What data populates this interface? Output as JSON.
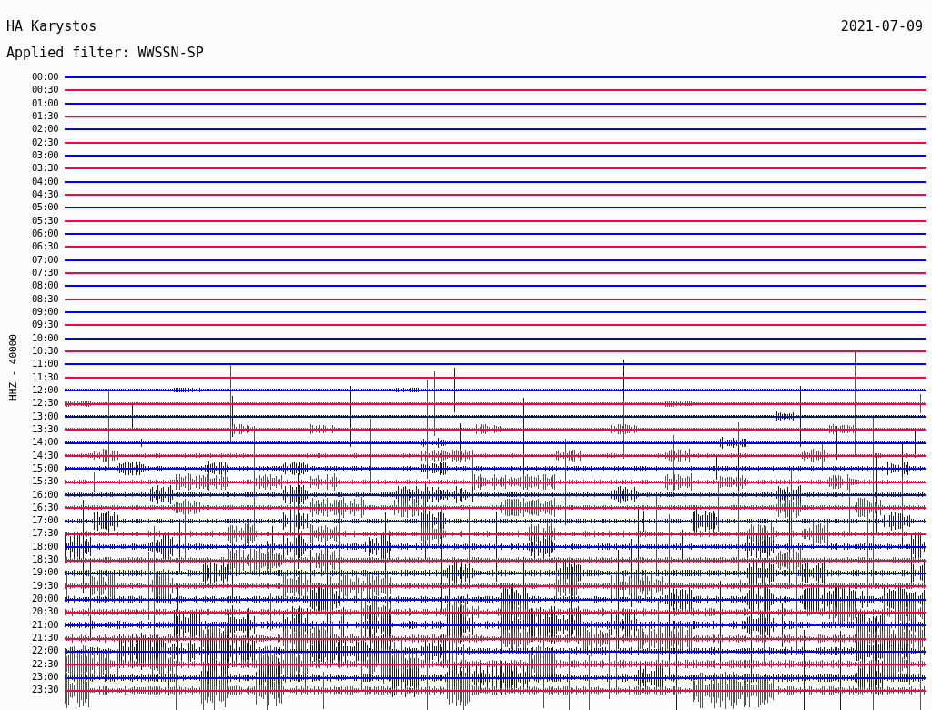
{
  "station": "HA Karystos",
  "date": "2021-07-09",
  "filter": "Applied filter: WWSSN-SP",
  "axis_label": "HHZ - 40000",
  "rows": [
    {
      "time": "00:00",
      "color": "#0000ff"
    },
    {
      "time": "00:30",
      "color": "#ff0040"
    },
    {
      "time": "01:00",
      "color": "#0000ff"
    },
    {
      "time": "01:30",
      "color": "#ff0040"
    },
    {
      "time": "02:00",
      "color": "#0000ff"
    },
    {
      "time": "02:30",
      "color": "#ff0040"
    },
    {
      "time": "03:00",
      "color": "#0000ff"
    },
    {
      "time": "03:30",
      "color": "#ff0040"
    },
    {
      "time": "04:00",
      "color": "#0000ff"
    },
    {
      "time": "04:30",
      "color": "#ff0040"
    },
    {
      "time": "05:00",
      "color": "#0000ff"
    },
    {
      "time": "05:30",
      "color": "#ff0040"
    },
    {
      "time": "06:00",
      "color": "#0000ff"
    },
    {
      "time": "06:30",
      "color": "#ff0040"
    },
    {
      "time": "07:00",
      "color": "#0000ff"
    },
    {
      "time": "07:30",
      "color": "#ff0040"
    },
    {
      "time": "08:00",
      "color": "#0000ff"
    },
    {
      "time": "08:30",
      "color": "#ff0040"
    },
    {
      "time": "09:00",
      "color": "#0000ff"
    },
    {
      "time": "09:30",
      "color": "#ff0040"
    },
    {
      "time": "10:00",
      "color": "#0000ff"
    },
    {
      "time": "10:30",
      "color": "#ff0040"
    },
    {
      "time": "11:00",
      "color": "#0000ff"
    },
    {
      "time": "11:30",
      "color": "#ff0040"
    },
    {
      "time": "12:00",
      "color": "#0000ff"
    },
    {
      "time": "12:30",
      "color": "#ff0040"
    },
    {
      "time": "13:00",
      "color": "#0000ff"
    },
    {
      "time": "13:30",
      "color": "#ff0040"
    },
    {
      "time": "14:00",
      "color": "#0000ff"
    },
    {
      "time": "14:30",
      "color": "#ff0040"
    },
    {
      "time": "15:00",
      "color": "#0000ff"
    },
    {
      "time": "15:30",
      "color": "#ff0040"
    },
    {
      "time": "16:00",
      "color": "#0000ff"
    },
    {
      "time": "16:30",
      "color": "#ff0040"
    },
    {
      "time": "17:00",
      "color": "#0000ff"
    },
    {
      "time": "17:30",
      "color": "#ff0040"
    },
    {
      "time": "18:00",
      "color": "#0000ff"
    },
    {
      "time": "18:30",
      "color": "#ff0040"
    },
    {
      "time": "19:00",
      "color": "#0000ff"
    },
    {
      "time": "19:30",
      "color": "#ff0040"
    },
    {
      "time": "20:00",
      "color": "#0000ff"
    },
    {
      "time": "20:30",
      "color": "#ff0040"
    },
    {
      "time": "21:00",
      "color": "#0000ff"
    },
    {
      "time": "21:30",
      "color": "#ff0040"
    },
    {
      "time": "22:00",
      "color": "#0000ff"
    },
    {
      "time": "22:30",
      "color": "#ff0040"
    },
    {
      "time": "23:00",
      "color": "#0000ff"
    },
    {
      "time": "23:30",
      "color": "#ff0040"
    }
  ]
}
